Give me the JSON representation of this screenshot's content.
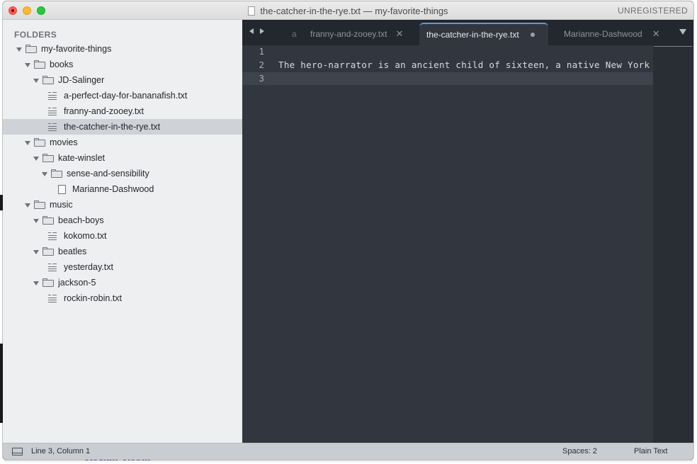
{
  "window": {
    "title": "the-catcher-in-the-rye.txt — my-favorite-things",
    "license": "UNREGISTERED"
  },
  "background": {
    "bottom_text": "Rockin' Robin"
  },
  "sidebar": {
    "heading": "FOLDERS",
    "tree": [
      {
        "label": "my-favorite-things",
        "type": "folder",
        "depth": 0
      },
      {
        "label": "books",
        "type": "folder",
        "depth": 1
      },
      {
        "label": "JD-Salinger",
        "type": "folder",
        "depth": 2
      },
      {
        "label": "a-perfect-day-for-bananafish.txt",
        "type": "text",
        "depth": 3
      },
      {
        "label": "franny-and-zooey.txt",
        "type": "text",
        "depth": 3
      },
      {
        "label": "the-catcher-in-the-rye.txt",
        "type": "text",
        "depth": 3,
        "selected": true
      },
      {
        "label": "movies",
        "type": "folder",
        "depth": 1
      },
      {
        "label": "kate-winslet",
        "type": "folder",
        "depth": 2
      },
      {
        "label": "sense-and-sensibility",
        "type": "folder",
        "depth": 3
      },
      {
        "label": "Marianne-Dashwood",
        "type": "file",
        "depth": 4
      },
      {
        "label": "music",
        "type": "folder",
        "depth": 1
      },
      {
        "label": "beach-boys",
        "type": "folder",
        "depth": 2
      },
      {
        "label": "kokomo.txt",
        "type": "text",
        "depth": 3
      },
      {
        "label": "beatles",
        "type": "folder",
        "depth": 2
      },
      {
        "label": "yesterday.txt",
        "type": "text",
        "depth": 3
      },
      {
        "label": "jackson-5",
        "type": "folder",
        "depth": 2
      },
      {
        "label": "rockin-robin.txt",
        "type": "text",
        "depth": 3
      }
    ]
  },
  "tabs": {
    "stub": "a",
    "franny": "franny-and-zooey.txt",
    "catcher": "the-catcher-in-the-rye.txt",
    "marianne": "Marianne-Dashwood",
    "close_glyph": "✕"
  },
  "editor": {
    "lines": [
      {
        "number": "1",
        "text": ""
      },
      {
        "number": "2",
        "text": "The hero-narrator is an ancient child of sixteen, a native New York"
      },
      {
        "number": "3",
        "text": ""
      }
    ],
    "current_line": 3
  },
  "status": {
    "cursor": "Line 3, Column 1",
    "indent": "Spaces: 2",
    "syntax": "Plain Text"
  },
  "colors": {
    "accent": "#5d9ad9",
    "editor_bg": "#31363f",
    "sidebar_bg": "#eeeff0"
  }
}
